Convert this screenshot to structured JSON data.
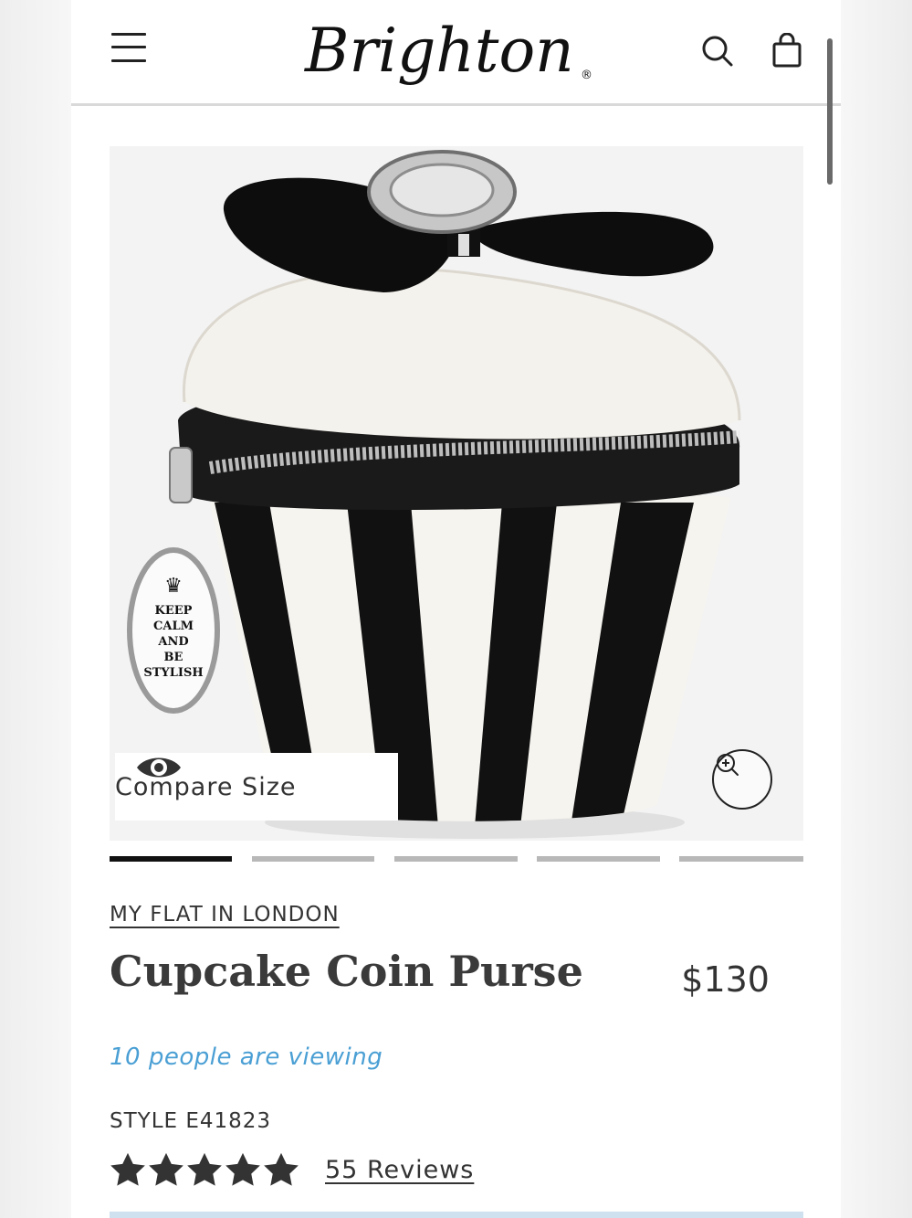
{
  "header": {
    "brand": "Brighton",
    "brand_mark": "®",
    "menu_icon": "hamburger-menu-icon",
    "search_icon": "search-icon",
    "cart_icon": "shopping-bag-icon"
  },
  "gallery": {
    "image_alt": "Cupcake Coin Purse",
    "charm_text": [
      "KEEP",
      "CALM",
      "AND",
      "BE",
      "STYLISH"
    ],
    "compare_label": "Compare Size",
    "compare_icon": "eye-icon",
    "zoom_icon": "zoom-in-icon",
    "slide_count": 5,
    "active_slide": 1
  },
  "product": {
    "collection": "MY FLAT IN LONDON",
    "title": "Cupcake Coin Purse",
    "price": "$130",
    "viewing": "10 people are viewing",
    "style": "STYLE E41823",
    "rating": 5,
    "reviews": "55 Reviews"
  },
  "colors": {
    "accent_blue": "#4a9fd4",
    "text": "#333333",
    "divider": "#d9d9d9"
  }
}
